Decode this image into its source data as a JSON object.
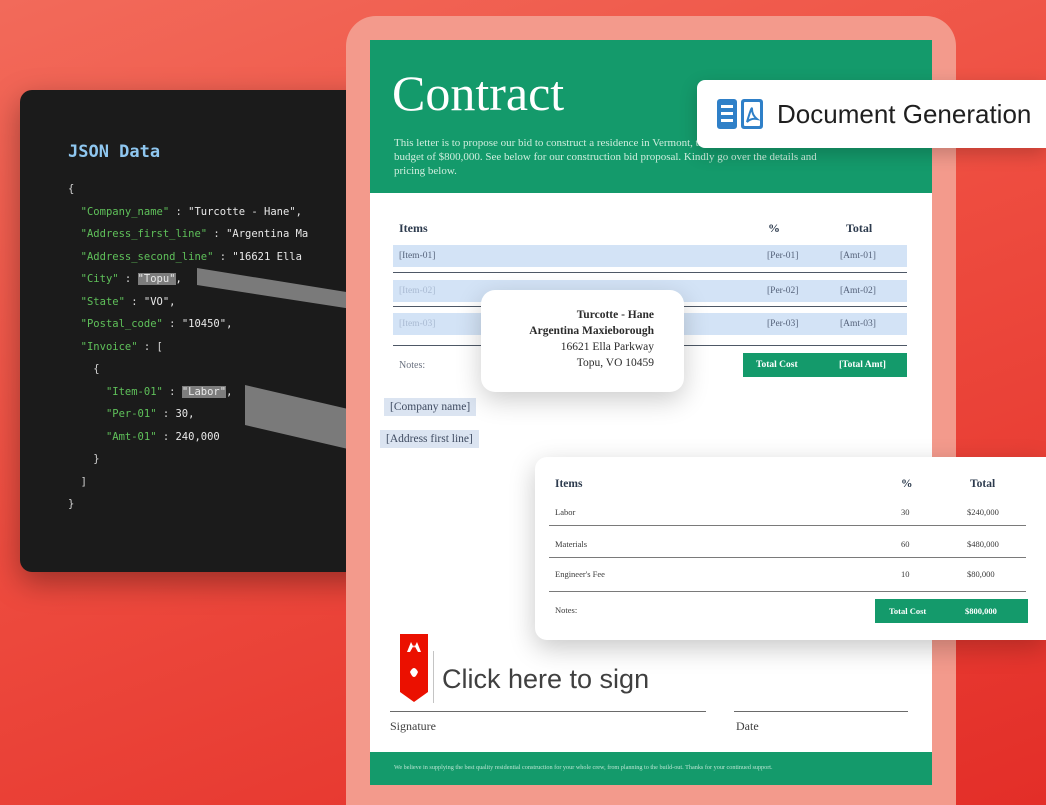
{
  "code": {
    "title": "JSON Data",
    "lines": [
      {
        "indent": 0,
        "parts": [
          {
            "t": "{",
            "c": "p"
          }
        ]
      },
      {
        "indent": 1,
        "parts": [
          {
            "t": "\"Company_name\"",
            "c": "k"
          },
          {
            "t": " : ",
            "c": "p"
          },
          {
            "t": "\"Turcotte - Hane\",",
            "c": "s"
          }
        ]
      },
      {
        "indent": 1,
        "parts": [
          {
            "t": "\"Address_first_line\"",
            "c": "k"
          },
          {
            "t": " : ",
            "c": "p"
          },
          {
            "t": "\"Argentina Ma",
            "c": "s"
          }
        ]
      },
      {
        "indent": 1,
        "parts": [
          {
            "t": "\"Address_second_line\"",
            "c": "k"
          },
          {
            "t": " : ",
            "c": "p"
          },
          {
            "t": "\"16621 Ella",
            "c": "s"
          }
        ]
      },
      {
        "indent": 1,
        "parts": [
          {
            "t": "\"City\"",
            "c": "k"
          },
          {
            "t": " : ",
            "c": "p"
          },
          {
            "t": "\"Topu\"",
            "c": "hl"
          },
          {
            "t": ",",
            "c": "s"
          }
        ]
      },
      {
        "indent": 1,
        "parts": [
          {
            "t": "\"State\"",
            "c": "k"
          },
          {
            "t": " : ",
            "c": "p"
          },
          {
            "t": "\"VO\",",
            "c": "s"
          }
        ]
      },
      {
        "indent": 1,
        "parts": [
          {
            "t": "\"Postal_code\"",
            "c": "k"
          },
          {
            "t": " : ",
            "c": "p"
          },
          {
            "t": "\"10450\",",
            "c": "s"
          }
        ]
      },
      {
        "indent": 1,
        "parts": [
          {
            "t": "\"Invoice\"",
            "c": "k"
          },
          {
            "t": " : [",
            "c": "p"
          }
        ]
      },
      {
        "indent": 2,
        "parts": [
          {
            "t": "{",
            "c": "p"
          }
        ]
      },
      {
        "indent": 3,
        "parts": [
          {
            "t": "\"Item-01\"",
            "c": "k"
          },
          {
            "t": " : ",
            "c": "p"
          },
          {
            "t": "\"Labor\"",
            "c": "hl"
          },
          {
            "t": ",",
            "c": "s"
          }
        ]
      },
      {
        "indent": 3,
        "parts": [
          {
            "t": "\"Per-01\"",
            "c": "k"
          },
          {
            "t": " : ",
            "c": "p"
          },
          {
            "t": "30,",
            "c": "s"
          }
        ]
      },
      {
        "indent": 3,
        "parts": [
          {
            "t": "\"Amt-01\"",
            "c": "k"
          },
          {
            "t": " : ",
            "c": "p"
          },
          {
            "t": "240,000",
            "c": "s"
          }
        ]
      },
      {
        "indent": 2,
        "parts": [
          {
            "t": "}",
            "c": "p"
          }
        ]
      },
      {
        "indent": 1,
        "parts": [
          {
            "t": "]",
            "c": "p"
          }
        ]
      },
      {
        "indent": 0,
        "parts": [
          {
            "t": "}",
            "c": "p"
          }
        ]
      }
    ]
  },
  "badge": {
    "label": "Document Generation",
    "icons": [
      "database-icon",
      "pdf-icon"
    ]
  },
  "doc": {
    "title": "Contract",
    "intro": "This letter is to propose our bid to construct a residence in Vermont, this October, for an estimated budget of $800,000. See below for our construction bid proposal. Kindly go over the details and pricing below.",
    "table": {
      "headers": {
        "items": "Items",
        "percent": "%",
        "total": "Total"
      },
      "rows": [
        {
          "item": "[Item-01]",
          "per": "[Per-01]",
          "amt": "[Amt-01]"
        },
        {
          "item": "[Item-02]",
          "per": "[Per-02]",
          "amt": "[Amt-02]"
        },
        {
          "item": "[Item-03]",
          "per": "[Per-03]",
          "amt": "[Amt-03]"
        }
      ],
      "notes_label": "Notes:",
      "total_label": "Total Cost",
      "total_value": "[Total Amt]"
    },
    "company_field": "[Company name]",
    "address_field": "[Address first line]",
    "sign_prompt": "Click here to sign",
    "signature_label": "Signature",
    "date_label": "Date",
    "footer": "We believe in supplying the best quality residential construction for your whole crew, from planning to the build-out. Thanks for your continued support."
  },
  "address_card": {
    "lines": [
      "Turcotte - Hane",
      "Argentina Maxieborough",
      "16621 Ella Parkway",
      "Topu, VO 10459"
    ]
  },
  "items_card": {
    "headers": {
      "items": "Items",
      "percent": "%",
      "total": "Total"
    },
    "rows": [
      {
        "item": "Labor",
        "per": "30",
        "amt": "$240,000"
      },
      {
        "item": "Materials",
        "per": "60",
        "amt": "$480,000"
      },
      {
        "item": "Engineer's Fee",
        "per": "10",
        "amt": "$80,000"
      }
    ],
    "notes_label": "Notes:",
    "total_label": "Total Cost",
    "total_value": "$800,000"
  },
  "colors": {
    "background": "#ee4d40",
    "brand_green": "#149a6b",
    "code_key": "#5fc05a",
    "adobe_red": "#eb1000",
    "icon_blue": "#2f80c8"
  }
}
